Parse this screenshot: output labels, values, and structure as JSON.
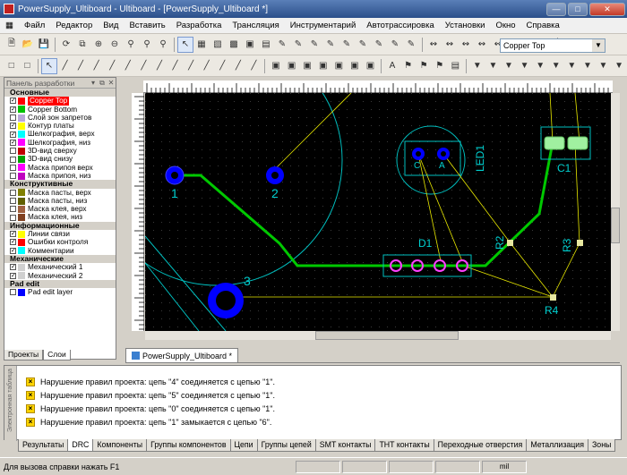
{
  "window": {
    "title": "PowerSupply_Ultiboard - Ultiboard - [PowerSupply_Ultiboard *]"
  },
  "menu": [
    "Файл",
    "Редактор",
    "Вид",
    "Вставить",
    "Разработка",
    "Трансляция",
    "Инструментарий",
    "Автотрассировка",
    "Установки",
    "Окно",
    "Справка"
  ],
  "layer_select": {
    "value": "Copper Top"
  },
  "panel": {
    "title": "Панель разработки",
    "groups": [
      {
        "label": "Основные",
        "layers": [
          {
            "label": "Copper Top",
            "color": "#ff0000",
            "checked": true,
            "selected": true
          },
          {
            "label": "Copper Bottom",
            "color": "#00c000",
            "checked": true
          },
          {
            "label": "Слой зон запретов",
            "color": "#b8a8d8",
            "checked": false
          },
          {
            "label": "Контур платы",
            "color": "#ffff00",
            "checked": true
          },
          {
            "label": "Шелкография, верх",
            "color": "#00ffff",
            "checked": true
          },
          {
            "label": "Шелкография, низ",
            "color": "#ff00ff",
            "checked": true
          },
          {
            "label": "3D-вид сверху",
            "color": "#c00000",
            "checked": false
          },
          {
            "label": "3D-вид снизу",
            "color": "#00a000",
            "checked": false
          },
          {
            "label": "Маска припоя верх",
            "color": "#ff00ff",
            "checked": false
          },
          {
            "label": "Маска припоя, низ",
            "color": "#c000c0",
            "checked": false
          }
        ]
      },
      {
        "label": "Конструктивные",
        "layers": [
          {
            "label": "Маска пасты, верх",
            "color": "#808000",
            "checked": false
          },
          {
            "label": "Маска пасты, низ",
            "color": "#606000",
            "checked": false
          },
          {
            "label": "Маска клея, верх",
            "color": "#a06040",
            "checked": false
          },
          {
            "label": "Маска клея, низ",
            "color": "#804020",
            "checked": false
          }
        ]
      },
      {
        "label": "Информационные",
        "layers": [
          {
            "label": "Линии связи",
            "color": "#ffff00",
            "checked": true
          },
          {
            "label": "Ошибки контроля",
            "color": "#ff0000",
            "checked": true
          },
          {
            "label": "Комментарии",
            "color": "#00ffff",
            "checked": true
          }
        ]
      },
      {
        "label": "Механические",
        "layers": [
          {
            "label": "Механический 1",
            "color": "#d0d0d0",
            "checked": true
          },
          {
            "label": "Механический 2",
            "color": "#d0d0d0",
            "checked": true
          }
        ]
      },
      {
        "label": "Pad edit",
        "layers": [
          {
            "label": "Pad edit layer",
            "color": "#0000ff",
            "checked": false
          }
        ]
      }
    ],
    "tabs": [
      "Проекты",
      "Слои"
    ]
  },
  "board": {
    "labels": {
      "p1": "1",
      "p2": "2",
      "p3": "3",
      "d1": "D1",
      "led": "LED1",
      "ca": "C",
      "an": "A",
      "c1": "C1",
      "r2": "R2",
      "r3": "R3",
      "r4": "R4"
    }
  },
  "doc_tab": "PowerSupply_Ultiboard *",
  "results": {
    "side_label": "Электронная таблица",
    "messages": [
      "Нарушение правил проекта: цепь \"4\" соединяется с цепью \"1\".",
      "Нарушение правил проекта: цепь \"5\" соединяется с цепью \"1\".",
      "Нарушение правил проекта: цепь \"0\" соединяется с цепью \"1\".",
      "Нарушение правил проекта: цепь \"1\" замыкается с цепью \"6\"."
    ]
  },
  "bottom_tabs": [
    "Результаты",
    "DRC",
    "Компоненты",
    "Группы компонентов",
    "Цепи",
    "Группы цепей",
    "SMT контакты",
    "THT контакты",
    "Переходные отверстия",
    "Металлизация",
    "Зоны"
  ],
  "status": {
    "text": "Для вызова справки нажать F1",
    "unit": "mil"
  }
}
